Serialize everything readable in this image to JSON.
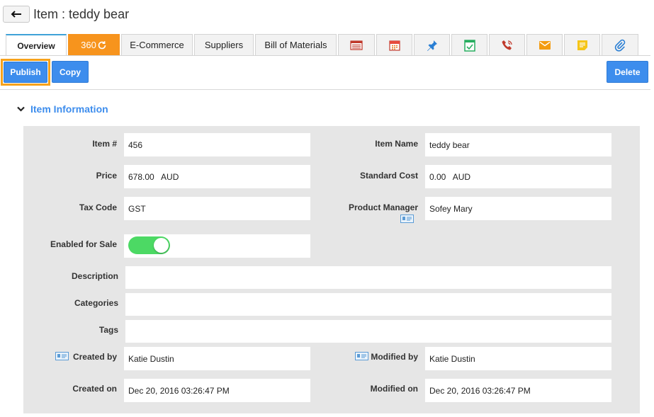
{
  "header": {
    "title": "Item : teddy bear"
  },
  "tabs": {
    "overview": "Overview",
    "three_sixty": "360",
    "ecommerce": "E-Commerce",
    "suppliers": "Suppliers",
    "bom": "Bill of Materials",
    "icons": [
      "report-icon",
      "calendar-icon",
      "pin-icon",
      "task-icon",
      "phone-icon",
      "email-icon",
      "note-icon",
      "attachment-icon"
    ]
  },
  "actions": {
    "publish": "Publish",
    "copy": "Copy",
    "delete": "Delete"
  },
  "section": {
    "title": "Item Information"
  },
  "fields": {
    "item_no": {
      "label": "Item #",
      "value": "456"
    },
    "item_name": {
      "label": "Item Name",
      "value": "teddy bear"
    },
    "price": {
      "label": "Price",
      "value": "678.00   AUD"
    },
    "standard_cost": {
      "label": "Standard Cost",
      "value": "0.00   AUD"
    },
    "tax_code": {
      "label": "Tax Code",
      "value": "GST"
    },
    "product_manager": {
      "label": "Product Manager",
      "value": "Sofey Mary"
    },
    "enabled_for_sale": {
      "label": "Enabled for Sale",
      "value": true
    },
    "description": {
      "label": "Description",
      "value": ""
    },
    "categories": {
      "label": "Categories",
      "value": ""
    },
    "tags": {
      "label": "Tags",
      "value": ""
    },
    "created_by": {
      "label": "Created by",
      "value": "Katie Dustin"
    },
    "modified_by": {
      "label": "Modified by",
      "value": "Katie Dustin"
    },
    "created_on": {
      "label": "Created on",
      "value": "Dec 20, 2016 03:26:47 PM"
    },
    "modified_on": {
      "label": "Modified on",
      "value": "Dec 20, 2016 03:26:47 PM"
    }
  },
  "colors": {
    "accent": "#3d8ded",
    "orange": "#f7941d",
    "toggle_on": "#4cd964",
    "panel": "#e6e6e6"
  }
}
